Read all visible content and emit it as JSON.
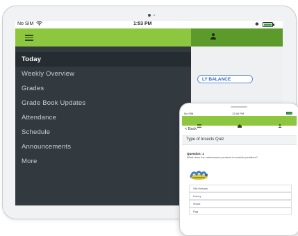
{
  "tablet": {
    "status": {
      "carrier": "No SIM",
      "time": "1:53 PM",
      "battery_icon": "battery-icon"
    },
    "balance_label": "LY BALANCE",
    "menu": [
      {
        "label": "Today",
        "active": true
      },
      {
        "label": "Weekly Overview",
        "active": false
      },
      {
        "label": "Grades",
        "active": false
      },
      {
        "label": "Grade Book Updates",
        "active": false
      },
      {
        "label": "Attendance",
        "active": false
      },
      {
        "label": "Schedule",
        "active": false
      },
      {
        "label": "Announcements",
        "active": false
      },
      {
        "label": "More",
        "active": false
      }
    ]
  },
  "phone": {
    "status": {
      "carrier": "No SIM",
      "time": "12:46 PM"
    },
    "back_label": "< Back",
    "title": "Type of Insects Quiz",
    "question_label": "Question: 1",
    "question_text": "What does the cankerworm produce to enable predators?",
    "options": [
      "Silk threads",
      "Honey",
      "Wood",
      "Egg"
    ]
  },
  "colors": {
    "brand_green": "#8dc63f",
    "dark_green": "#5d9a2c",
    "drawer_bg": "#323a40",
    "active_item_bg": "#262d32",
    "balance_blue": "#2f67c0"
  }
}
